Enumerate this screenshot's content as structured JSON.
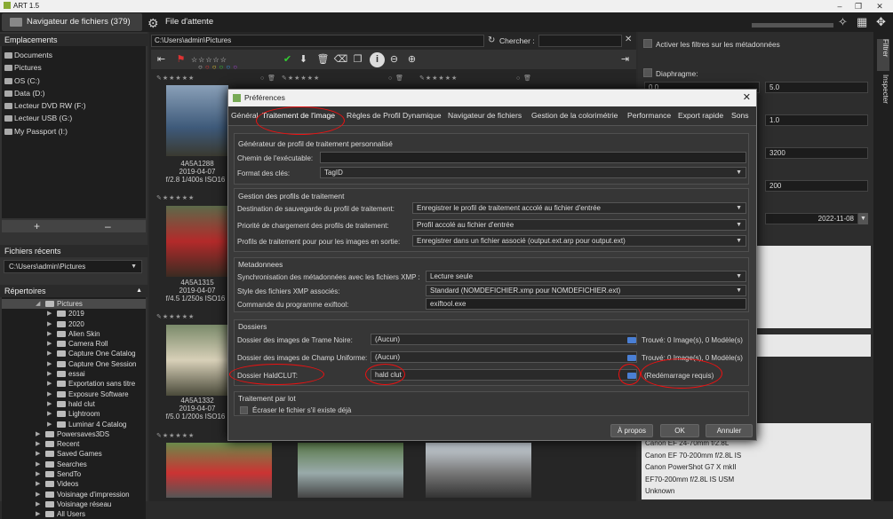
{
  "window": {
    "title": "ART 1.5",
    "controls": [
      "–",
      "❐",
      "✕"
    ]
  },
  "tabs": {
    "browser": "Navigateur de fichiers  (379)",
    "queue": "File d'attente"
  },
  "left": {
    "places_header": "Emplacements",
    "places": [
      "Documents",
      "Pictures",
      "OS (C:)",
      "Data (D:)",
      "Lecteur DVD RW (F:)",
      "Lecteur USB (G:)",
      "My Passport (I:)"
    ],
    "add": "+",
    "remove": "–",
    "recent_header": "Fichiers récents",
    "recent_value": "C:\\Users\\admin\\Pictures",
    "dirs_header": "Répertoires",
    "dirs_selected": "Pictures",
    "dirs": [
      "2019",
      "2020",
      "Alien Skin",
      "Camera Roll",
      "Capture One Catalog",
      "Capture One Session",
      "essai",
      "Exportation sans titre",
      "Exposure Software",
      "hald clut",
      "Lightroom",
      "Luminar 4 Catalog"
    ],
    "dirs2": [
      "Powersaves3DS",
      "Recent",
      "Saved Games",
      "Searches",
      "SendTo",
      "Videos",
      "Voisinage d'impression",
      "Voisinage réseau",
      "All Users"
    ]
  },
  "browser": {
    "path": "C:\\Users\\admin\\Pictures",
    "search_label": "Chercher :",
    "search_value": "",
    "thumbs": [
      {
        "name": "4A5A1288",
        "date": "2019-04-07",
        "exif": "f/2.8 1/400s ISO16"
      },
      {
        "name": "4A5A1315",
        "date": "2019-04-07",
        "exif": "f/4.5 1/250s ISO16"
      },
      {
        "name": "4A5A1332",
        "date": "2019-04-07",
        "exif": "f/5.0 1/200s ISO16"
      }
    ]
  },
  "right": {
    "meta_filter": "Activer les filtres sur les métadonnées",
    "aperture": "Diaphragme:",
    "f1": "0.0",
    "f2": "5.0",
    "f3": "1.0",
    "f4": "3200",
    "f5": "200",
    "date": "2022-11-08",
    "lenses": [
      "Canon EF 24-70mm f/2.8L",
      "Canon EF 70-200mm f/2.8L IS",
      "Canon PowerShot G7 X mkII",
      "EF70-200mm f/2.8L IS USM",
      "Unknown"
    ]
  },
  "vtabs": {
    "filter": "Filtrer",
    "inspect": "Inspecter"
  },
  "dialog": {
    "title": "Préférences",
    "tabs": [
      "Général",
      "Traitement de l'image",
      "Règles de Profil Dynamique",
      "Navigateur de fichiers",
      "Gestion de la colorimétrie",
      "Performance",
      "Export rapide",
      "Sons"
    ],
    "gen": {
      "header": "Générateur de profil de traitement personnalisé",
      "exe_label": "Chemin de l'exécutable:",
      "exe_value": "",
      "keys_label": "Format des clés:",
      "keys_value": "TagID"
    },
    "prof": {
      "header": "Gestion des profils de traitement",
      "rows": [
        {
          "label": "Destination de sauvegarde du profil de traitement:",
          "value": "Enregistrer le profil de traitement accolé au fichier d'entrée"
        },
        {
          "label": "Priorité de chargement des profils de traitement:",
          "value": "Profil accolé au fichier d'entrée"
        },
        {
          "label": "Profils de traitement pour pour les images en sortie:",
          "value": "Enregistrer dans un fichier associé (output.ext.arp pour output.ext)"
        }
      ]
    },
    "meta": {
      "header": "Metadonnees",
      "sync_label": "Synchronisation des métadonnées avec les fichiers XMP :",
      "sync_value": "Lecture seule",
      "xmp_label": "Style des fichiers XMP associés:",
      "xmp_value": "Standard (NOMDEFICHIER.xmp pour NOMDEFICHIER.ext)",
      "exif_label": "Commande du programme exiftool:",
      "exif_value": "exiftool.exe"
    },
    "dirs": {
      "header": "Dossiers",
      "rows": [
        {
          "label": "Dossier des images de Trame Noire:",
          "value": "(Aucun)",
          "status": "Trouvé: 0 Image(s), 0 Modèle(s)"
        },
        {
          "label": "Dossier des images de Champ Uniforme:",
          "value": "(Aucun)",
          "status": "Trouvé: 0 Image(s), 0 Modèle(s)"
        },
        {
          "label": "Dossier HaldCLUT:",
          "value": "hald clut",
          "status": "(Redémarrage requis)"
        }
      ]
    },
    "batch": {
      "header": "Traitement par lot",
      "overwrite": "Écraser le fichier s'il existe déjà"
    },
    "btn_about": "À propos",
    "btn_ok": "OK",
    "btn_cancel": "Annuler"
  }
}
